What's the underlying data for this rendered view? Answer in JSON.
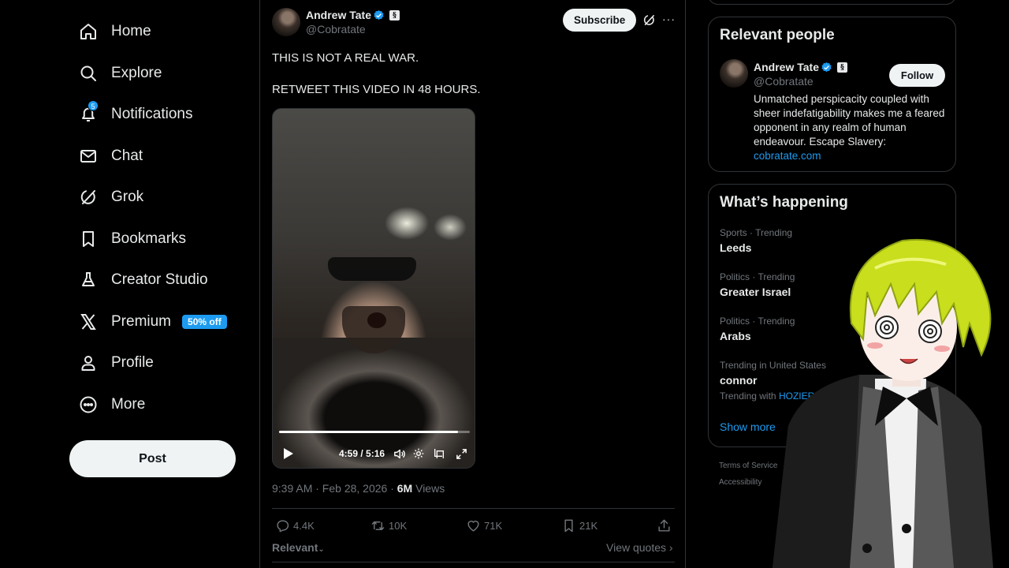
{
  "nav": {
    "items": [
      {
        "label": "Home",
        "icon": "home-icon"
      },
      {
        "label": "Explore",
        "icon": "search-icon"
      },
      {
        "label": "Notifications",
        "icon": "bell-icon",
        "badge": "5"
      },
      {
        "label": "Chat",
        "icon": "envelope-icon"
      },
      {
        "label": "Grok",
        "icon": "grok-icon"
      },
      {
        "label": "Bookmarks",
        "icon": "bookmark-icon"
      },
      {
        "label": "Creator Studio",
        "icon": "flask-icon"
      },
      {
        "label": "Premium",
        "icon": "x-logo-icon",
        "badge": "50% off"
      },
      {
        "label": "Profile",
        "icon": "person-icon"
      },
      {
        "label": "More",
        "icon": "more-circle-icon"
      }
    ],
    "post_label": "Post"
  },
  "tweet": {
    "author_name": "Andrew Tate",
    "author_handle": "@Cobratate",
    "subscribe_label": "Subscribe",
    "text": "THIS IS NOT A REAL WAR.\n\nRETWEET THIS VIDEO IN 48 HOURS.",
    "video": {
      "time": "4:59 / 5:16",
      "progress": 0.94
    },
    "meta": {
      "timestamp": "9:39 AM · Feb 28, 2026 · ",
      "views_count": "6M",
      "views_label": " Views"
    },
    "actions": {
      "replies": "4.4K",
      "reposts": "10K",
      "likes": "71K",
      "bookmarks": "21K"
    },
    "sort_label": "Relevant",
    "view_quotes_label": "View quotes"
  },
  "relevant_people": {
    "title": "Relevant people",
    "name": "Andrew Tate",
    "handle": "@Cobratate",
    "follow_label": "Follow",
    "bio": "Unmatched perspicacity coupled with sheer indefatigability makes me a feared opponent in any realm of human endeavour. Escape Slavery: ",
    "bio_link": "cobratate.com"
  },
  "whats_happening": {
    "title": "What’s happening",
    "trends": [
      {
        "category": "Sports · Trending",
        "name": "Leeds"
      },
      {
        "category": "Politics · Trending",
        "name": "Greater Israel"
      },
      {
        "category": "Politics · Trending",
        "name": "Arabs"
      },
      {
        "category": "Trending in United States",
        "name": "connor",
        "with_label": "Trending with ",
        "with_links": "HOZIER, MUMF"
      }
    ],
    "show_more": "Show more"
  },
  "footer": {
    "terms": "Terms of Service",
    "accessibility": "Accessibility"
  },
  "colors": {
    "background": "#000000",
    "accent": "#1d9bf0",
    "text": "#e7e9ea",
    "secondary": "#71767b",
    "border": "#2f3336"
  }
}
